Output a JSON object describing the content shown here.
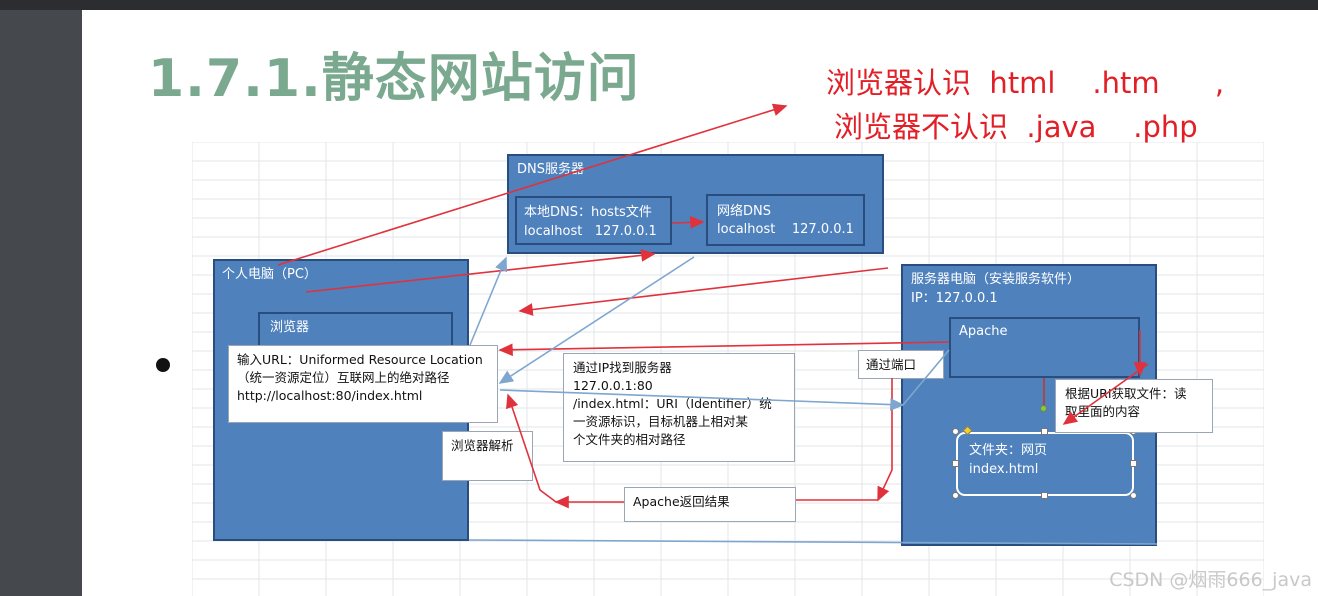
{
  "slide": {
    "title": "1.7.1.静态网站访问",
    "note_line1": "浏览器认识  html    .htm      ,",
    "note_line2": "浏览器不认识  .java    .php"
  },
  "diagram": {
    "dns_server": {
      "title": "DNS服务器",
      "local_dns_line1": "本地DNS：hosts文件",
      "local_dns_line2": "localhost   127.0.0.1",
      "net_dns_line1": "网络DNS",
      "net_dns_line2": "localhost    127.0.0.1"
    },
    "pc": {
      "title": "个人电脑（PC）",
      "browser_title": "浏览器",
      "url_line1": "输入URL：Uniformed Resource Location",
      "url_line2": "（统一资源定位）互联网上的绝对路径",
      "url_line3": "http://localhost:80/index.html"
    },
    "server": {
      "title": "服务器电脑（安装服务软件）",
      "ip": "IP：127.0.0.1",
      "apache": "Apache",
      "folder_line1": "文件夹：网页",
      "folder_line2": "index.html"
    },
    "ip_box_line1": "通过IP找到服务器",
    "ip_box_line2": "127.0.0.1:80",
    "ip_box_line3": "/index.html：URI（Identifier）统",
    "ip_box_line4": "一资源标识，目标机器上相对某",
    "ip_box_line5": "个文件夹的相对路径",
    "port_label": "通过端口",
    "parse_label": "浏览器解析",
    "return_label": "Apache返回结果",
    "uri_label_line1": "根据URI获取文件：读",
    "uri_label_line2": "取里面的内容"
  },
  "watermark": "CSDN @烟雨666_java",
  "colors": {
    "title_green": "#7aa98f",
    "note_red": "#e21f26",
    "box_blue": "#4f81bd",
    "arrow_red": "#e0323c",
    "arrow_blue": "#7ea6cf"
  }
}
